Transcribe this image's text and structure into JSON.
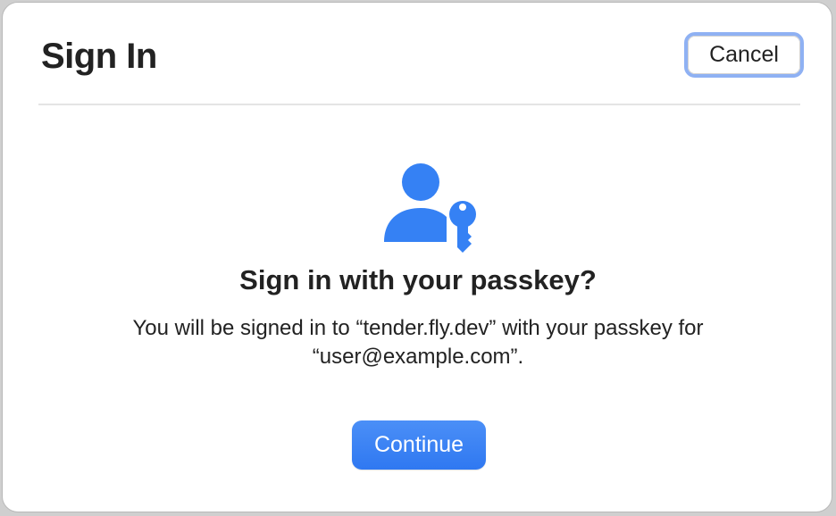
{
  "dialog": {
    "title": "Sign In",
    "cancel_label": "Cancel",
    "icon": "person-with-key-icon",
    "heading": "Sign in with your passkey?",
    "message": "You will be signed in to “tender.fly.dev” with your passkey for “user@example.com”.",
    "continue_label": "Continue"
  },
  "colors": {
    "accent": "#3581F4",
    "focus_ring": "#8FB1F3",
    "text": "#222222"
  }
}
